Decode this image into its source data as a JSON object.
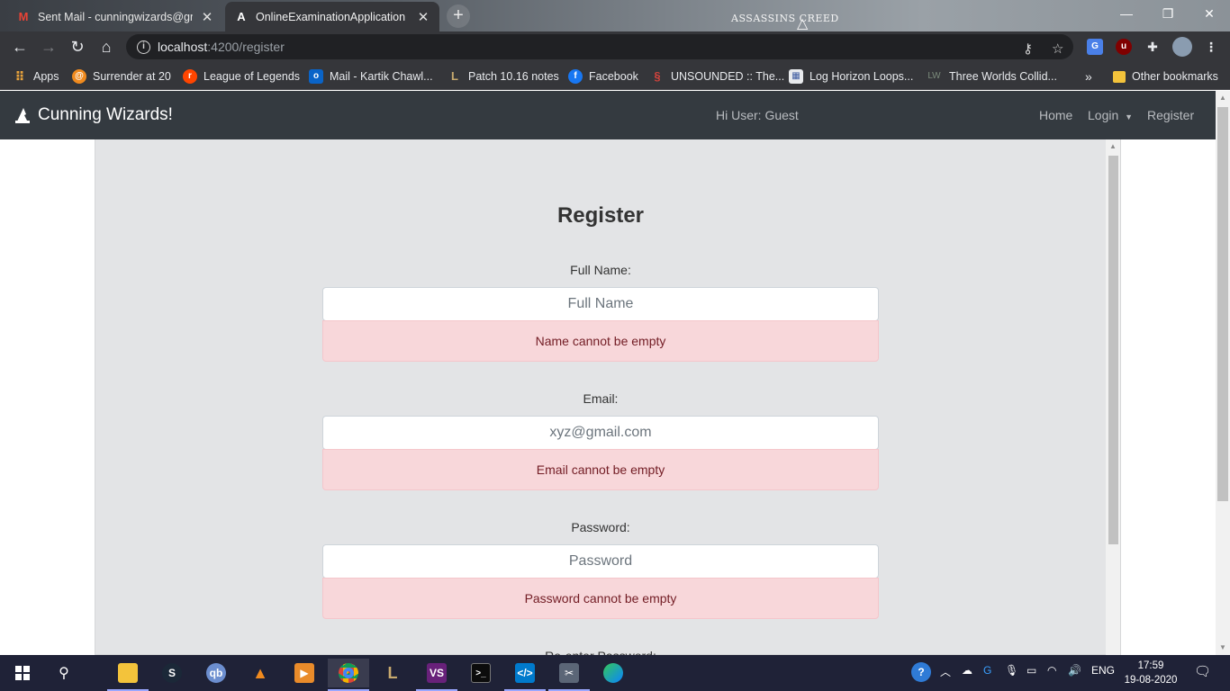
{
  "browser": {
    "tabs": [
      {
        "title": "Sent Mail - cunningwizards@gm",
        "icon": "gmail-icon",
        "active": false
      },
      {
        "title": "OnlineExaminationApplication",
        "icon": "angular-icon",
        "active": true
      }
    ],
    "new_tab": "+",
    "url_host": "localhost",
    "url_path": ":4200/register",
    "window_logo": "ASSASSINS CREED",
    "bookmarks": [
      {
        "label": "Apps",
        "icon": "apps-grid-icon",
        "color": "#e8a33c"
      },
      {
        "label": "Surrender at 20",
        "icon": "surrender-icon",
        "color": "#f08a1e"
      },
      {
        "label": "League of Legends",
        "icon": "reddit-icon",
        "color": "#ff4500"
      },
      {
        "label": "Mail - Kartik Chawl...",
        "icon": "outlook-icon",
        "color": "#0a64c8"
      },
      {
        "label": "Patch 10.16 notes",
        "icon": "league-icon",
        "color": "#c8aa6e"
      },
      {
        "label": "Facebook",
        "icon": "facebook-icon",
        "color": "#1877f2"
      },
      {
        "label": "UNSOUNDED :: The...",
        "icon": "unsounded-icon",
        "color": "#d2433c"
      },
      {
        "label": "Log Horizon Loops...",
        "icon": "log-horizon-icon",
        "color": "#3c5aa0"
      },
      {
        "label": "Three Worlds Collid...",
        "icon": "lw-icon",
        "color": "#5b6b5b"
      },
      {
        "label": "Other bookmarks",
        "icon": "folder-icon",
        "color": "#f3c33b"
      }
    ],
    "overflow": "»"
  },
  "app": {
    "brand": "Cunning Wizards!",
    "greeting": "Hi User: Guest",
    "nav": {
      "home": "Home",
      "login": "Login",
      "register": "Register"
    }
  },
  "form": {
    "title": "Register",
    "fields": [
      {
        "label": "Full Name:",
        "placeholder": "Full Name",
        "error": "Name cannot be empty"
      },
      {
        "label": "Email:",
        "placeholder": "xyz@gmail.com",
        "error": "Email cannot be empty"
      },
      {
        "label": "Password:",
        "placeholder": "Password",
        "error": "Password cannot be empty"
      }
    ],
    "next_label": "Re-enter Password:"
  },
  "taskbar": {
    "apps": [
      "file-explorer-icon",
      "steam-icon",
      "qbittorrent-icon",
      "vlc-icon",
      "media-player-icon",
      "chrome-icon",
      "league-client-icon",
      "visual-studio-icon",
      "terminal-icon",
      "vscode-icon",
      "snipping-tool-icon",
      "edge-icon"
    ],
    "lang": "ENG",
    "time": "17:59",
    "date": "19-08-2020"
  },
  "colors": {
    "navbar": "#343a40",
    "card": "#e3e4e6",
    "alert_bg": "#f8d7da",
    "alert_text": "#721c24"
  }
}
